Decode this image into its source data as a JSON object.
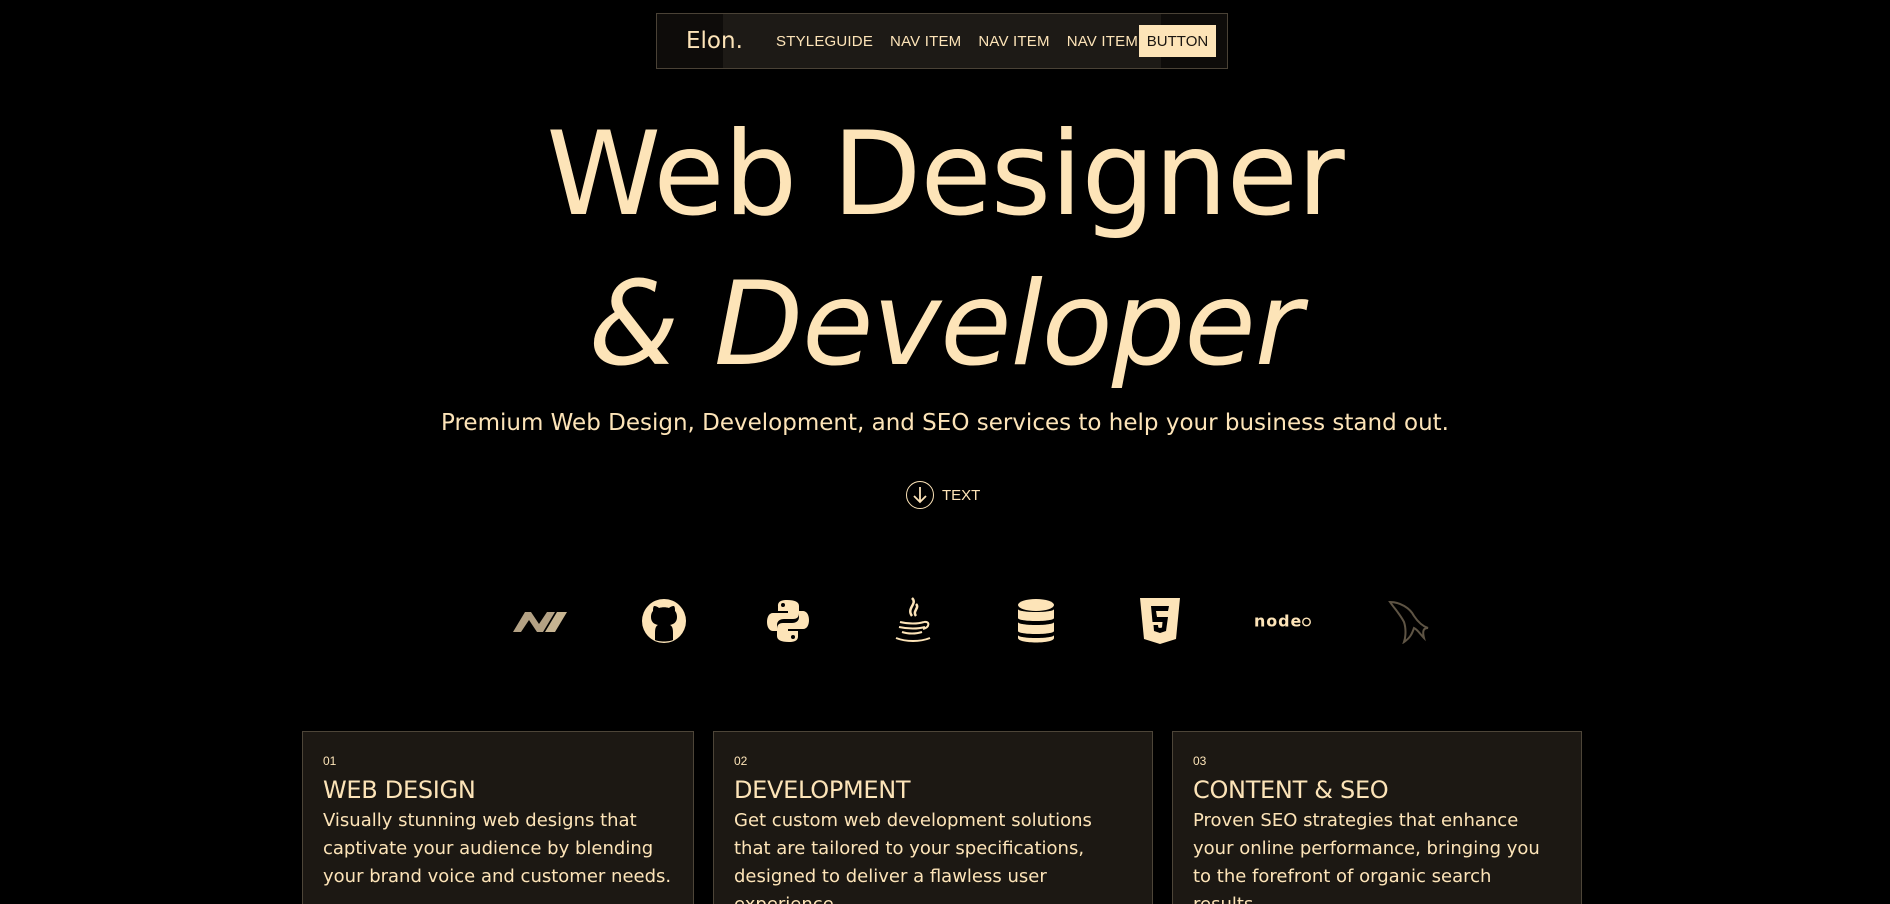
{
  "nav": {
    "logo": "Elon.",
    "links": [
      "STYLEGUIDE",
      "NAV ITEM",
      "NAV ITEM",
      "NAV ITEM"
    ],
    "button": "BUTTON"
  },
  "hero": {
    "line1": "Web Designer",
    "line2": "& Developer",
    "subtitle": "Premium Web Design, Development, and SEO services to help your business stand out.",
    "scroll_label": "TEXT"
  },
  "tech_logos": [
    "dotnet-icon",
    "github-icon",
    "python-icon",
    "java-icon",
    "database-icon",
    "html5-icon",
    "nodejs-icon",
    "mysql-icon"
  ],
  "services": [
    {
      "num": "01",
      "title": "WEB DESIGN",
      "desc": "Visually stunning web designs that captivate your audience by blending your brand voice and customer needs."
    },
    {
      "num": "02",
      "title": "DEVELOPMENT",
      "desc": "Get custom web development solutions that are tailored to your specifications, designed to deliver a flawless user experience."
    },
    {
      "num": "03",
      "title": "CONTENT & SEO",
      "desc": "Proven SEO strategies that enhance your online performance, bringing you to the forefront of organic search results."
    }
  ],
  "colors": {
    "accent": "#fde4b8",
    "background": "#000000",
    "card": "#1c1813"
  }
}
